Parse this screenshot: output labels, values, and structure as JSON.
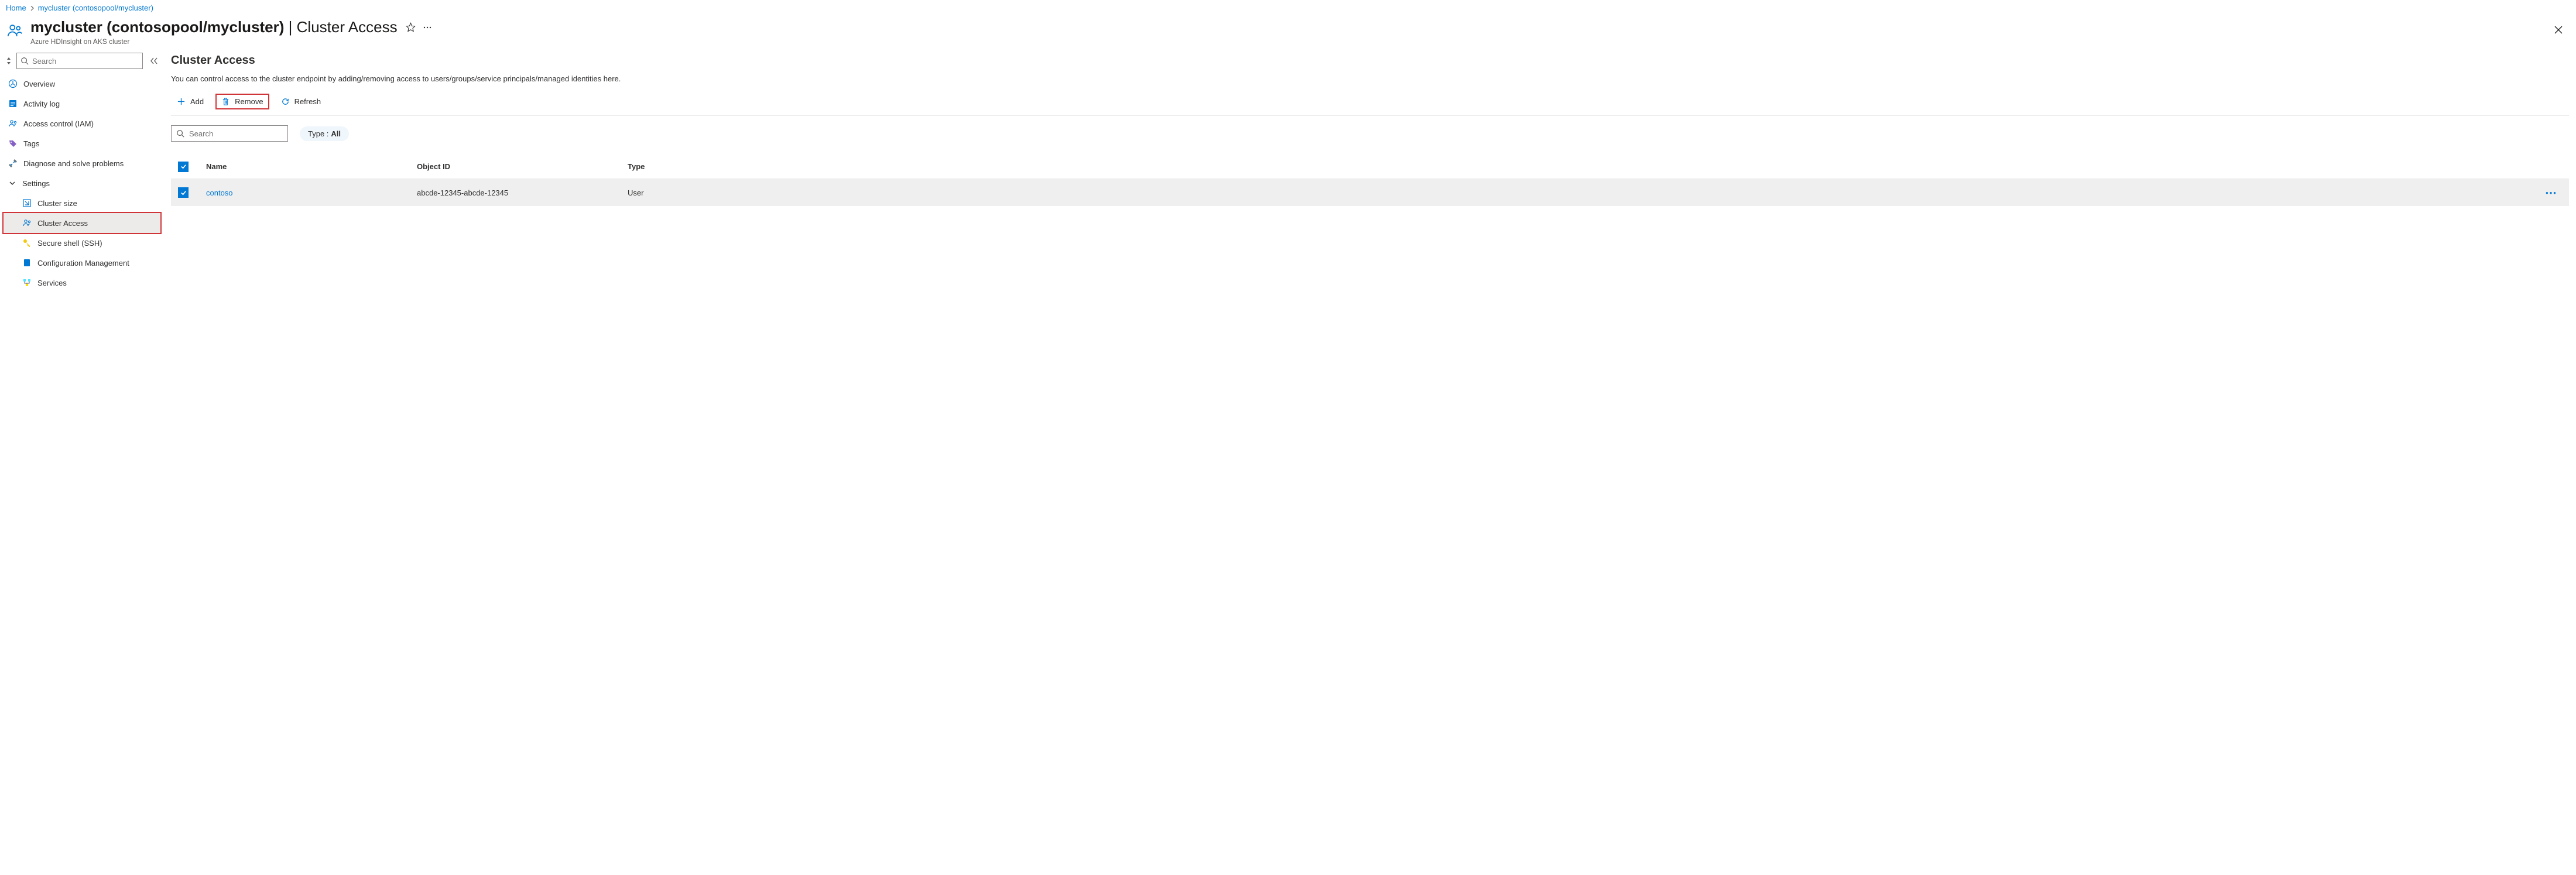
{
  "breadcrumb": {
    "home": "Home",
    "current": "mycluster (contosopool/mycluster)"
  },
  "header": {
    "title_main": "mycluster (contosopool/mycluster)",
    "title_sub": "Cluster Access",
    "subtitle": "Azure HDInsight on AKS cluster"
  },
  "sidebar": {
    "search_placeholder": "Search",
    "items": {
      "overview": "Overview",
      "activity_log": "Activity log",
      "iam": "Access control (IAM)",
      "tags": "Tags",
      "diagnose": "Diagnose and solve problems",
      "settings": "Settings",
      "cluster_size": "Cluster size",
      "cluster_access": "Cluster Access",
      "ssh": "Secure shell (SSH)",
      "config_mgmt": "Configuration Management",
      "services": "Services"
    }
  },
  "main": {
    "title": "Cluster Access",
    "description": "You can control access to the cluster endpoint by adding/removing access to users/groups/service principals/managed identities here.",
    "toolbar": {
      "add": "Add",
      "remove": "Remove",
      "refresh": "Refresh"
    },
    "filters": {
      "search_placeholder": "Search",
      "type_label": "Type :",
      "type_value": "All"
    },
    "table": {
      "headers": {
        "name": "Name",
        "object_id": "Object ID",
        "type": "Type"
      },
      "rows": [
        {
          "name": "contoso",
          "object_id": "abcde-12345-abcde-12345",
          "type": "User"
        }
      ]
    }
  }
}
